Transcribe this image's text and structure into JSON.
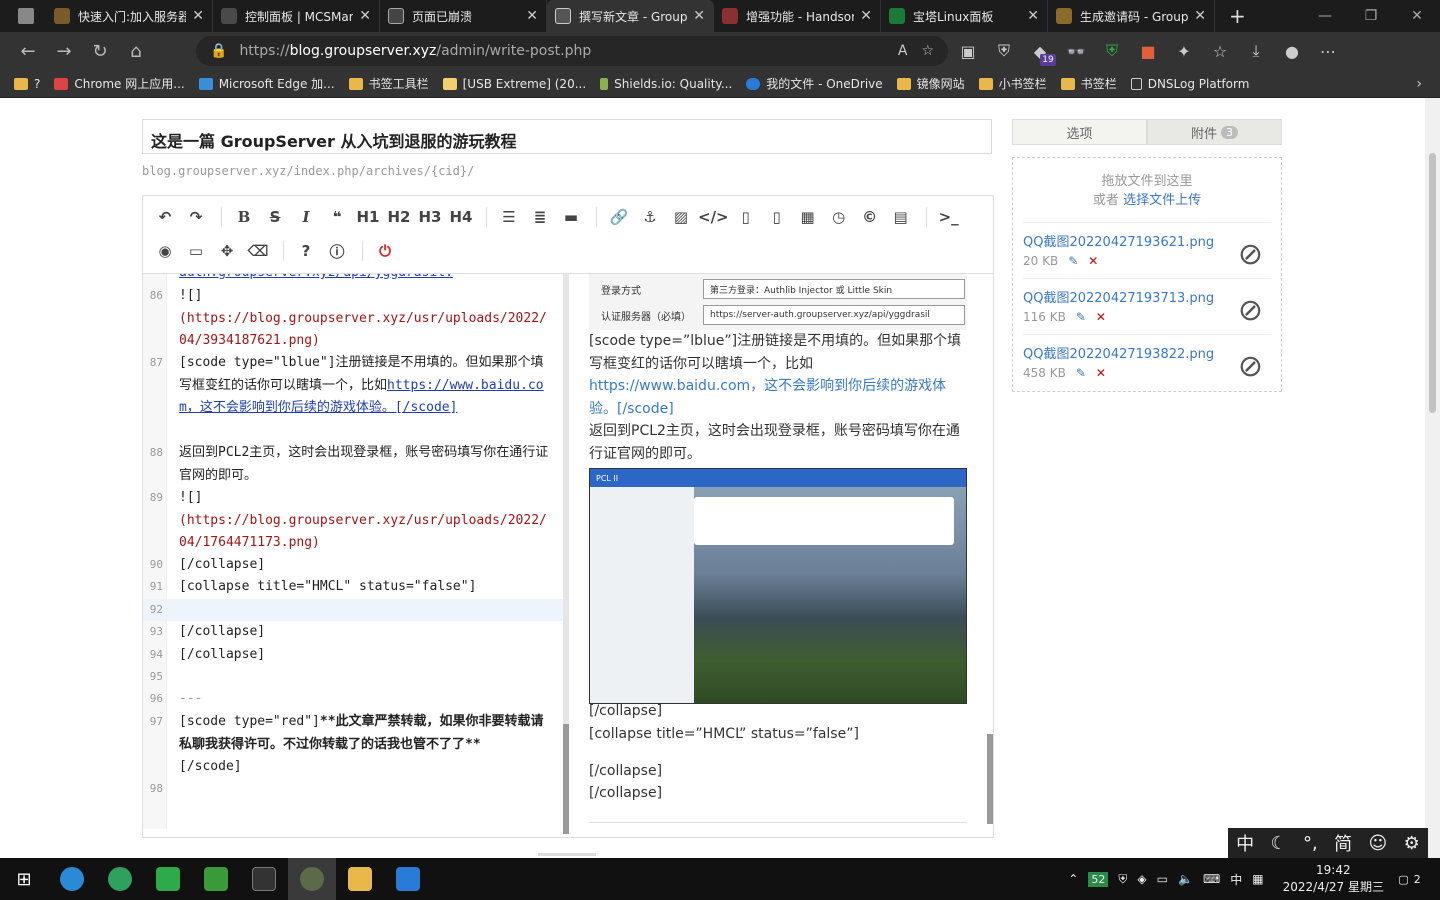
{
  "browser": {
    "tabs": [
      {
        "title": "快速入门:加入服务器",
        "color": "#7a5a2a",
        "active": false
      },
      {
        "title": "控制面板 | MCSManager",
        "color": "#4a4a4a",
        "active": false
      },
      {
        "title": "页面已崩溃",
        "color": "#444444",
        "active": false
      },
      {
        "title": "撰写新文章 - GroupServer",
        "color": "#555555",
        "active": true
      },
      {
        "title": "增强功能 - Handsome",
        "color": "#8a3030",
        "active": false
      },
      {
        "title": "宝塔Linux面板",
        "color": "#1a7a3a",
        "active": false
      },
      {
        "title": "生成邀请码 - GroupServer",
        "color": "#8a6a2a",
        "active": false
      }
    ],
    "url_prefix": "https://",
    "url_domain": "blog.groupserver.xyz",
    "url_path": "/admin/write-post.php",
    "ext_badge": "19",
    "bookmarks": [
      "?",
      "Chrome 网上应用...",
      "Microsoft Edge 加...",
      "书签工具栏",
      "[USB Extreme] (20...",
      "Shields.io: Quality...",
      "我的文件 - OneDrive",
      "镜像网站",
      "小书签栏",
      "书签栏",
      "DNSLog Platform"
    ]
  },
  "post": {
    "title": "这是一篇 GroupServer 从入坑到退服的游玩教程",
    "slug": "blog.groupserver.xyz/index.php/archives/{cid}/"
  },
  "toolbar": {
    "h1": "H1",
    "h2": "H2",
    "h3": "H3",
    "h4": "H4",
    "bold": "B",
    "italic": "I",
    "strike": "S",
    "quote": "❝",
    "hr": "▬",
    "undo": "↶",
    "redo": "↷",
    "terminal": ">_"
  },
  "editor": {
    "top_partial": "auth.groupserver.xyz/api/yggdrasil.",
    "ln86": "86",
    "l86a": "![]",
    "l86b": "(https://blog.groupserver.xyz/usr/uploads/2022/04/3934187621.png)",
    "ln87": "87",
    "l87a": "[scode type=\"lblue\"]注册链接是不用填的。但如果那个填写框变红的话你可以瞎填一个，比如",
    "l87b": "https://www.baidu.com，这不会影响到你后续的游戏体验。[/scode]",
    "ln88": "88",
    "l88": "返回到PCL2主页，这时会出现登录框，账号密码填写你在通行证官网的即可。",
    "ln89": "89",
    "l89a": "![]",
    "l89b": "(https://blog.groupserver.xyz/usr/uploads/2022/04/1764471173.png)",
    "ln90": "90",
    "l90": "[/collapse]",
    "ln91": "91",
    "l91": "[collapse title=\"HMCL\" status=\"false\"]",
    "ln92": "92",
    "ln93": "93",
    "l93": "[/collapse]",
    "ln94": "94",
    "l94": "[/collapse]",
    "ln95": "95",
    "ln96": "96",
    "l96": "---",
    "ln97": "97",
    "l97a": "[scode type=\"red\"]",
    "l97b": "**此文章严禁转载，如果你非要转载请私聊我获得许可。不过你转载了的话我也管不了了**",
    "l97c": "[/scode]",
    "ln98": "98"
  },
  "preview": {
    "shot1_label1": "登录方式",
    "shot1_value1": "第三方登录：Authlib Injector 或 Little Skin",
    "shot1_label2": "认证服务器（必填）",
    "shot1_value2": "https://server-auth.groupserver.xyz/api/yggdrasil",
    "p1a": "[scode type=”lblue”]注册链接是不用填的。但如果那个填写框变红的话你可以瞎填一个，比如",
    "p1b": "https://www.baidu.com，这不会影响到你后续的游戏体验。[/scode]",
    "p2": "返回到PCL2主页，这时会出现登录框，账号密码填写你在通行证官网的即可。",
    "shot2_title": "PCL II",
    "p3": "[/collapse]",
    "p4": "[collapse title=”HMCL” status=”false”]",
    "p5": "[/collapse]",
    "p6": "[/collapse]"
  },
  "sidebar": {
    "tab_options": "选项",
    "tab_attach": "附件",
    "attach_count": "3",
    "drop_text": "拖放文件到这里",
    "or_text": "或者",
    "pick_text": "选择文件上传",
    "files": [
      {
        "name": "QQ截图20220427193621.png",
        "size": "20 KB"
      },
      {
        "name": "QQ截图20220427193713.png",
        "size": "116 KB"
      },
      {
        "name": "QQ截图20220427193822.png",
        "size": "458 KB"
      }
    ]
  },
  "ime": {
    "lang": "中",
    "mode": "简"
  },
  "taskbar": {
    "time": "19:42",
    "date": "2022/4/27 星期三",
    "temp": "52",
    "ime_lang": "中",
    "notif_count": "2"
  }
}
